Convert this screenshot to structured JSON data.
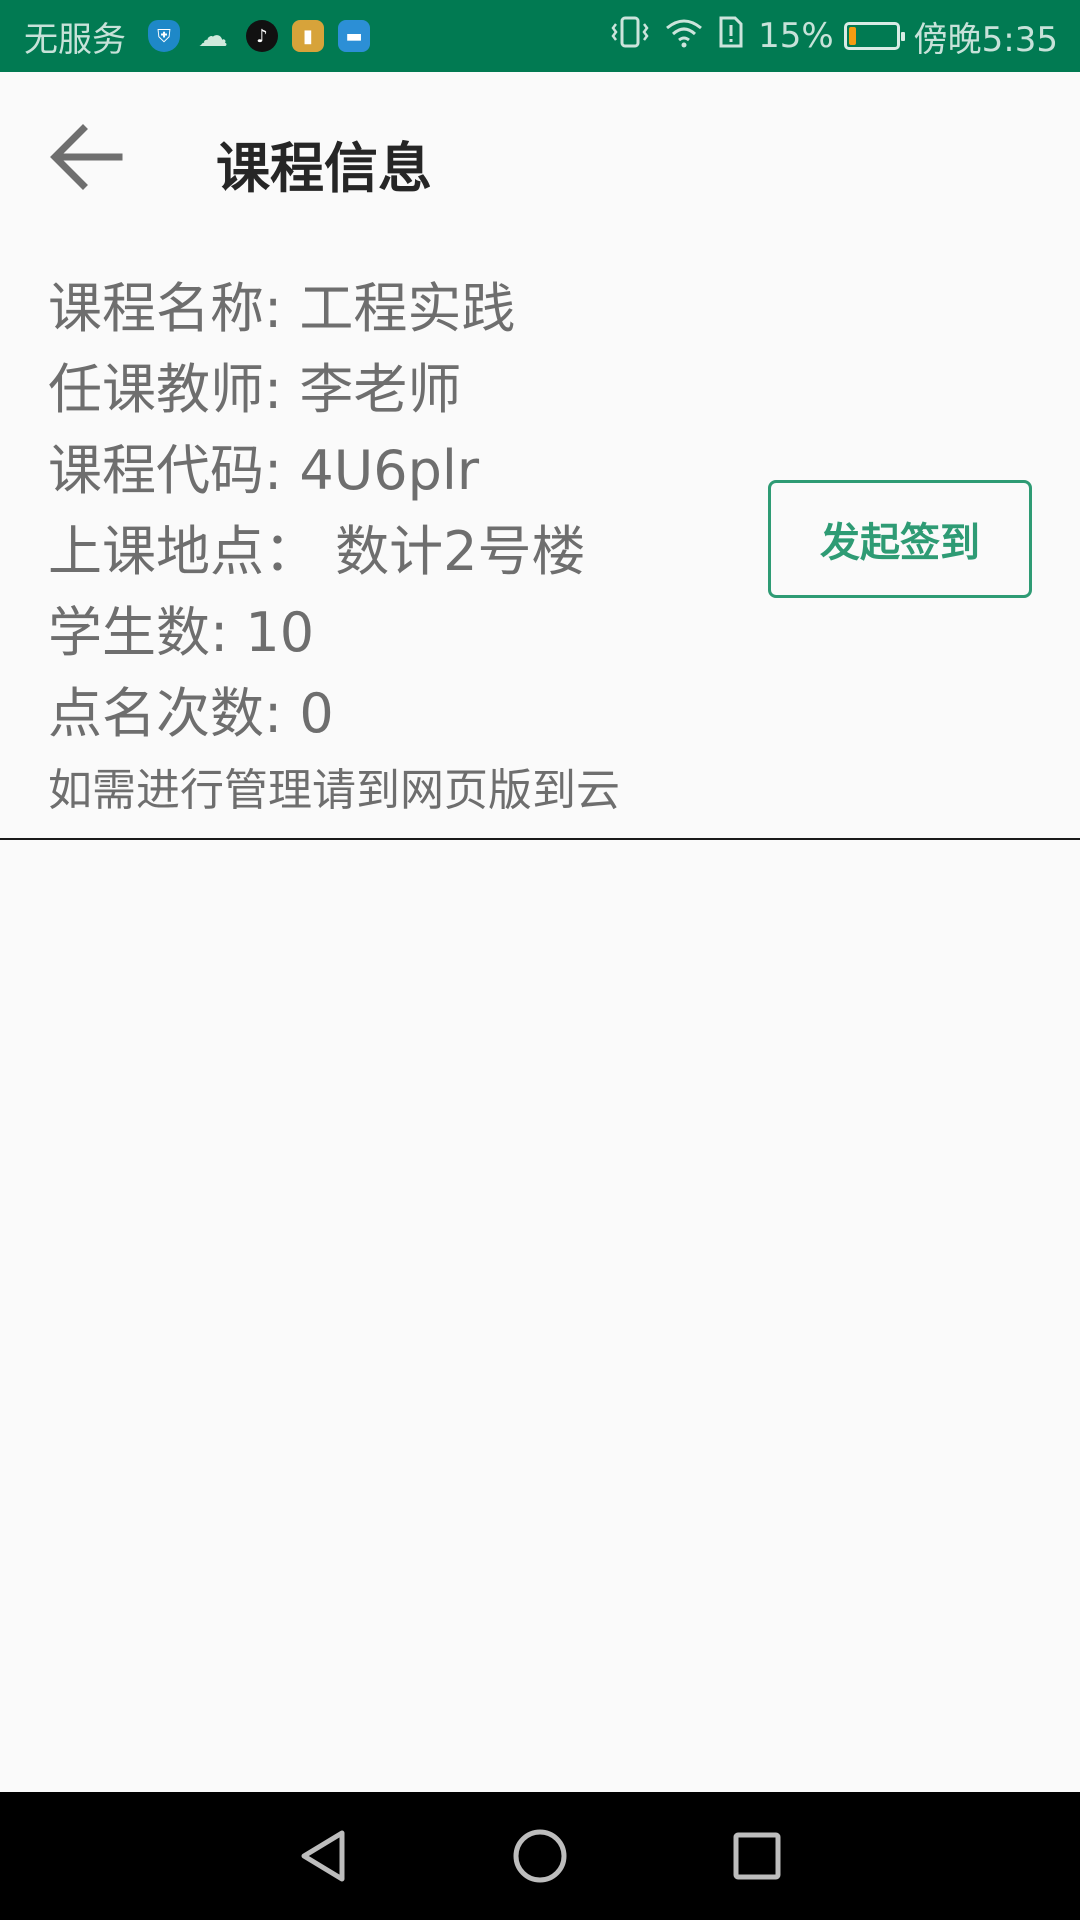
{
  "status_bar": {
    "carrier": "无服务",
    "battery_text": "15%",
    "battery_level": 0.15,
    "time": "傍晚5:35",
    "icons": [
      "shield-icon",
      "cloud-icon",
      "tiktok-icon",
      "zip-icon",
      "card-icon",
      "vibrate-icon",
      "wifi-icon",
      "sim-alert-icon",
      "battery-icon"
    ]
  },
  "header": {
    "title": "课程信息",
    "back_icon": "arrow-left-icon"
  },
  "course": {
    "name_line": "课程名称: 工程实践",
    "teacher_line": "任课教师: 李老师",
    "code_line": "课程代码: 4U6plr",
    "location_line": "上课地点： 数计2号楼",
    "students_line": "学生数: 10",
    "rollcall_line": "点名次数: 0",
    "hint": "如需进行管理请到网页版到云"
  },
  "actions": {
    "checkin_label": "发起签到"
  },
  "colors": {
    "status_bar": "#017a52",
    "accent": "#2e9b74",
    "text": "#6e6e6e",
    "title": "#262626"
  },
  "nav": {
    "icons": [
      "back-triangle-icon",
      "home-circle-icon",
      "recents-square-icon"
    ]
  }
}
